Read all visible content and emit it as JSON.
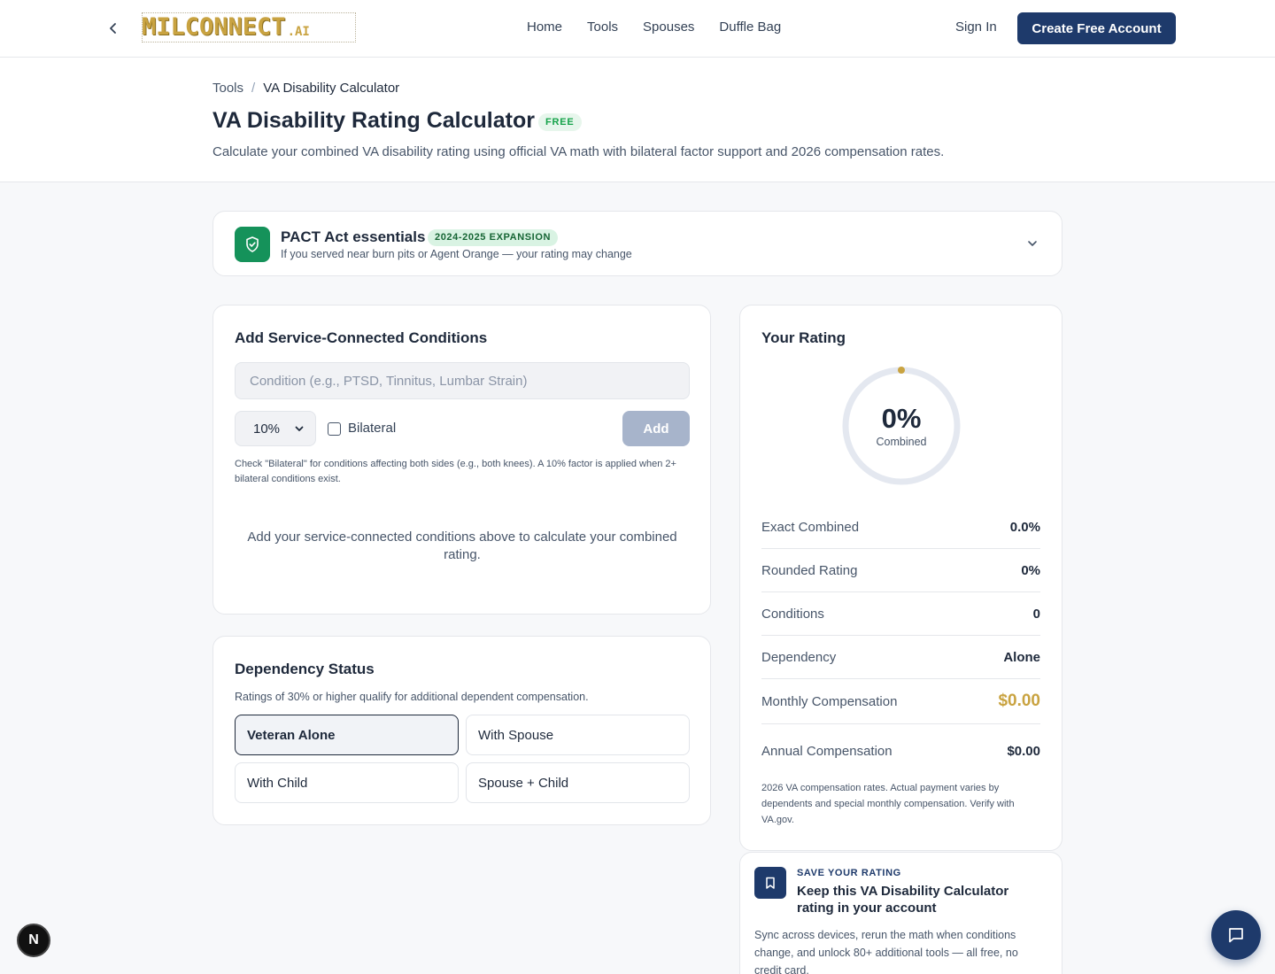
{
  "header": {
    "logo_text": "MILCONNECT",
    "logo_suffix": ".AI",
    "nav": [
      "Home",
      "Tools",
      "Spouses",
      "Duffle Bag"
    ],
    "sign_in": "Sign In",
    "create_account": "Create Free Account"
  },
  "breadcrumb": {
    "parent": "Tools",
    "separator": "/",
    "current": "VA Disability Calculator"
  },
  "page": {
    "title": "VA Disability Rating Calculator",
    "badge": "FREE",
    "subtitle": "Calculate your combined VA disability rating using official VA math with bilateral factor support and 2026 compensation rates."
  },
  "pact": {
    "title": "PACT Act essentials",
    "badge": "2024-2025 EXPANSION",
    "subtitle": "If you served near burn pits or Agent Orange — your rating may change"
  },
  "conditions": {
    "title": "Add Service-Connected Conditions",
    "input_placeholder": "Condition (e.g., PTSD, Tinnitus, Lumbar Strain)",
    "input_value": "",
    "percent_selected": "10%",
    "bilateral_label": "Bilateral",
    "bilateral_checked": false,
    "add_label": "Add",
    "help": "Check \"Bilateral\" for conditions affecting both sides (e.g., both knees). A 10% factor is applied when 2+ bilateral conditions exist.",
    "empty_state": "Add your service-connected conditions above to calculate your combined rating."
  },
  "dependency": {
    "title": "Dependency Status",
    "subtitle": "Ratings of 30% or higher qualify for additional dependent compensation.",
    "options": [
      "Veteran Alone",
      "With Spouse",
      "With Child",
      "Spouse + Child"
    ],
    "selected": "Veteran Alone"
  },
  "rating": {
    "title": "Your Rating",
    "ring_value": "0%",
    "ring_label": "Combined",
    "ring_fraction": 0,
    "rows": [
      {
        "label": "Exact Combined",
        "value": "0.0%"
      },
      {
        "label": "Rounded Rating",
        "value": "0%"
      },
      {
        "label": "Conditions",
        "value": "0"
      },
      {
        "label": "Dependency",
        "value": "Alone"
      },
      {
        "label": "Monthly Compensation",
        "value": "$0.00"
      },
      {
        "label": "Annual Compensation",
        "value": "$0.00"
      }
    ],
    "note": "2026 VA compensation rates. Actual payment varies by dependents and special monthly compensation. Verify with VA.gov."
  },
  "save": {
    "eyebrow": "SAVE YOUR RATING",
    "title": "Keep this VA Disability Calculator rating in your account",
    "body": "Sync across devices, rerun the math when conditions change, and unlock 80+ additional tools — all free, no credit card."
  },
  "floating": {
    "dev_badge": "N"
  },
  "colors": {
    "brand_navy": "#1e3a6b",
    "gold": "#c9a341",
    "pact_green": "#15925a",
    "free_green": "#16a34a"
  },
  "icons": {
    "back": "chevron-left-icon",
    "pact": "shield-check-icon",
    "pact_toggle": "chevron-down-icon",
    "select": "chevron-down-icon",
    "save": "bookmark-icon",
    "chat": "chat-bubble-icon"
  }
}
